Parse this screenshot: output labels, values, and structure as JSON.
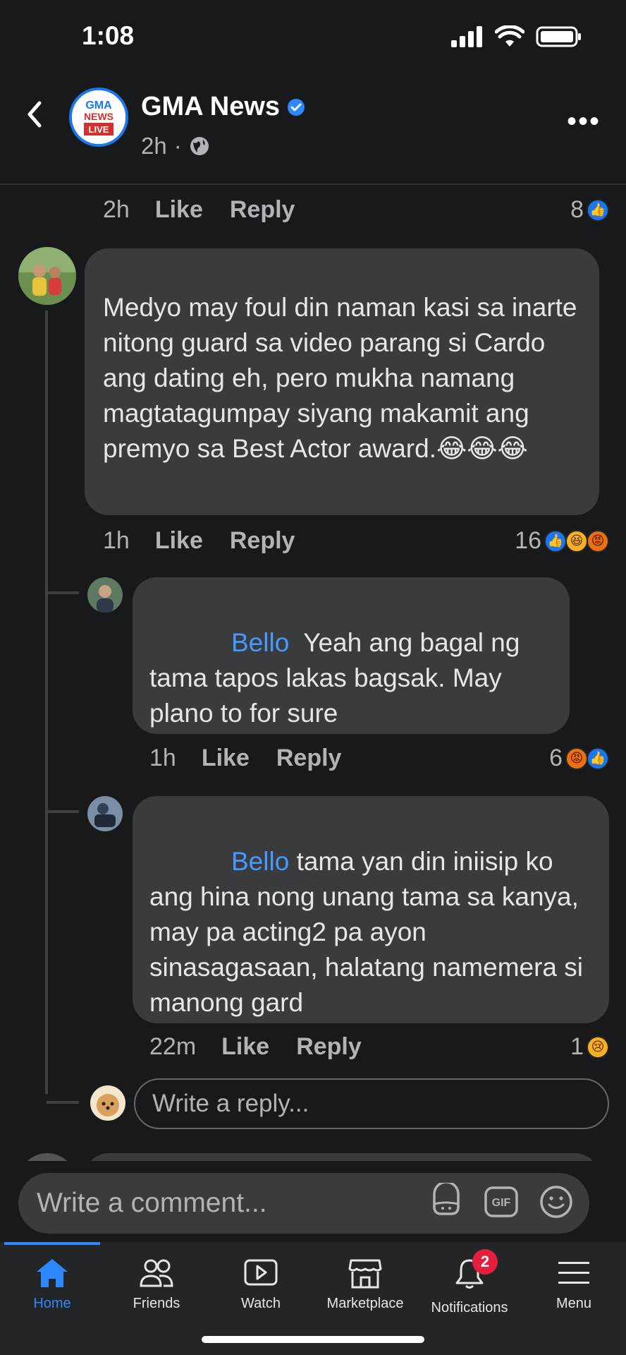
{
  "status": {
    "time": "1:08"
  },
  "header": {
    "page_name": "GMA News",
    "time": "2h",
    "logo_text_top": "GMA",
    "logo_text_mid": "NEWS",
    "logo_text_bottom": "LIVE"
  },
  "comments": [
    {
      "time": "2h",
      "like": "Like",
      "reply": "Reply",
      "reaction_count": "8"
    },
    {
      "text": "Medyo may foul din naman kasi sa inarte nitong guard sa video parang si Cardo ang dating eh, pero mukha namang magtatagumpay siyang makamit ang premyo sa Best Actor award.😂😂😂",
      "time": "1h",
      "like": "Like",
      "reply": "Reply",
      "reaction_count": "16"
    }
  ],
  "replies": [
    {
      "mention": "Bello",
      "text": "Yeah ang bagal ng tama tapos lakas bagsak. May plano to for sure",
      "time": "1h",
      "like": "Like",
      "reply": "Reply",
      "reaction_count": "6"
    },
    {
      "mention": "Bello",
      "text": "tama yan din iniisip ko ang hina nong unang tama sa kanya, may pa acting2 pa ayon sinasagasaan, halatang namemera si manong gard",
      "time": "22m",
      "like": "Like",
      "reply": "Reply",
      "reaction_count": "1"
    }
  ],
  "reply_input": {
    "placeholder": "Write a reply..."
  },
  "composer": {
    "placeholder": "Write a comment..."
  },
  "nav": [
    {
      "label": "Home"
    },
    {
      "label": "Friends"
    },
    {
      "label": "Watch"
    },
    {
      "label": "Marketplace"
    },
    {
      "label": "Notifications",
      "badge": "2"
    },
    {
      "label": "Menu"
    }
  ],
  "colors": {
    "accent": "#1877f2",
    "mention": "#4599ff",
    "bubble": "#3a3b3c",
    "background": "#18191a"
  }
}
